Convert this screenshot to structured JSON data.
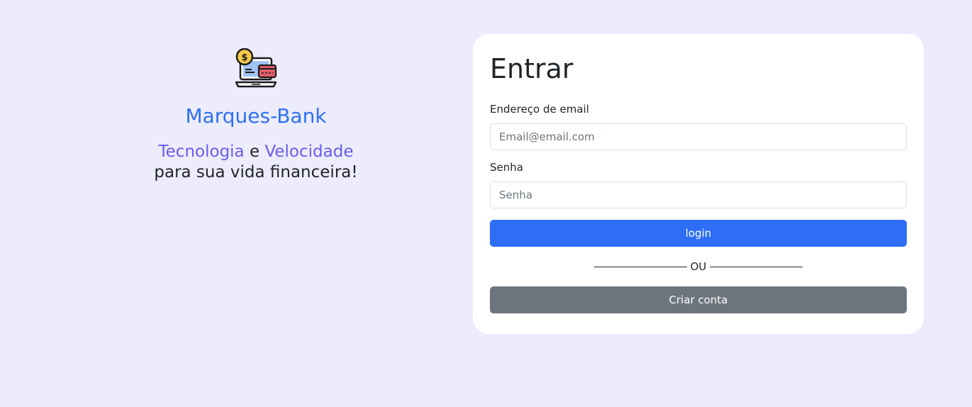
{
  "brand": {
    "name": "Marques-Bank",
    "tagline_word1": "Tecnologia",
    "tagline_connector": " e ",
    "tagline_word2": "Velocidade",
    "tagline_line2": "para sua vida financeira!",
    "logo_icon": "laptop-payment-icon"
  },
  "login_card": {
    "title": "Entrar",
    "email_label": "Endereço de email",
    "email_placeholder": "Email@email.com",
    "email_value": "",
    "password_label": "Senha",
    "password_placeholder": "Senha",
    "password_value": "",
    "login_button": "login",
    "divider_text": "OU",
    "create_account_button": "Criar conta"
  },
  "colors": {
    "background": "#ececfd",
    "brand_blue": "#2f6ff2",
    "accent_purple": "#6c5ce7",
    "primary_button": "#2e6ef7",
    "secondary_button": "#6c757d"
  }
}
